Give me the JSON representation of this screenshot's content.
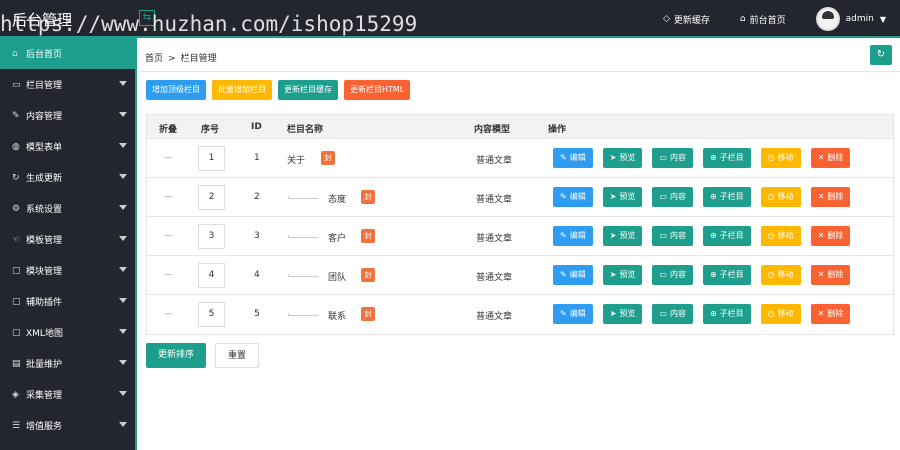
{
  "topbar": {
    "logo": "后台管理",
    "watermark": "https://www.huzhan.com/ishop15299",
    "clear_cache": "更新缓存",
    "front_home": "前台首页",
    "username": "admin"
  },
  "sidebar": {
    "items": [
      {
        "label": "后台首页",
        "icon": "home-icon",
        "has_arrow": false
      },
      {
        "label": "栏目管理",
        "icon": "monitor-icon",
        "has_arrow": true
      },
      {
        "label": "内容管理",
        "icon": "edit-icon",
        "has_arrow": true
      },
      {
        "label": "模型表单",
        "icon": "globe-icon",
        "has_arrow": true
      },
      {
        "label": "生成更新",
        "icon": "refresh-icon",
        "has_arrow": true
      },
      {
        "label": "系统设置",
        "icon": "gear-icon",
        "has_arrow": true
      },
      {
        "label": "模板管理",
        "icon": "hand-icon",
        "has_arrow": true
      },
      {
        "label": "模块管理",
        "icon": "folder-icon",
        "has_arrow": true
      },
      {
        "label": "辅助插件",
        "icon": "folder-icon",
        "has_arrow": true
      },
      {
        "label": "XML地图",
        "icon": "folder-icon",
        "has_arrow": true
      },
      {
        "label": "批量维护",
        "icon": "chart-icon",
        "has_arrow": true
      },
      {
        "label": "采集管理",
        "icon": "diamond-icon",
        "has_arrow": true
      },
      {
        "label": "增值服务",
        "icon": "list-icon",
        "has_arrow": true
      }
    ]
  },
  "breadcrumb": {
    "home": "首页",
    "separator": ">",
    "current": "栏目管理"
  },
  "actions": {
    "add_top": "增加顶级栏目",
    "batch_add": "批量增加栏目",
    "update_cache": "更新栏目缓存",
    "update_html": "更新栏目HTML"
  },
  "table": {
    "headers": {
      "fold": "折叠",
      "order": "序号",
      "id": "ID",
      "name": "栏目名称",
      "model": "内容模型",
      "ops": "操作"
    },
    "rows": [
      {
        "fold": "—",
        "order": "1",
        "id": "1",
        "name": "关于",
        "seal": "封",
        "model": "普通文章",
        "child": false
      },
      {
        "fold": "—",
        "order": "2",
        "id": "2",
        "name": "态度",
        "seal": "封",
        "model": "普通文章",
        "child": true
      },
      {
        "fold": "—",
        "order": "3",
        "id": "3",
        "name": "客户",
        "seal": "封",
        "model": "普通文章",
        "child": true
      },
      {
        "fold": "—",
        "order": "4",
        "id": "4",
        "name": "团队",
        "seal": "封",
        "model": "普通文章",
        "child": true
      },
      {
        "fold": "—",
        "order": "5",
        "id": "5",
        "name": "联系",
        "seal": "封",
        "model": "普通文章",
        "child": true
      }
    ],
    "op_labels": {
      "edit": "编辑",
      "preview": "预览",
      "content": "内容",
      "child": "子栏目",
      "move": "移动",
      "delete": "删除"
    }
  },
  "bottom": {
    "update_order": "更新排序",
    "reset": "重置"
  },
  "colors": {
    "topbar": "#23262e",
    "accent": "#1e9e8c",
    "blue": "#2d9cf1",
    "yellow": "#ffb800",
    "orange": "#fa6232"
  }
}
